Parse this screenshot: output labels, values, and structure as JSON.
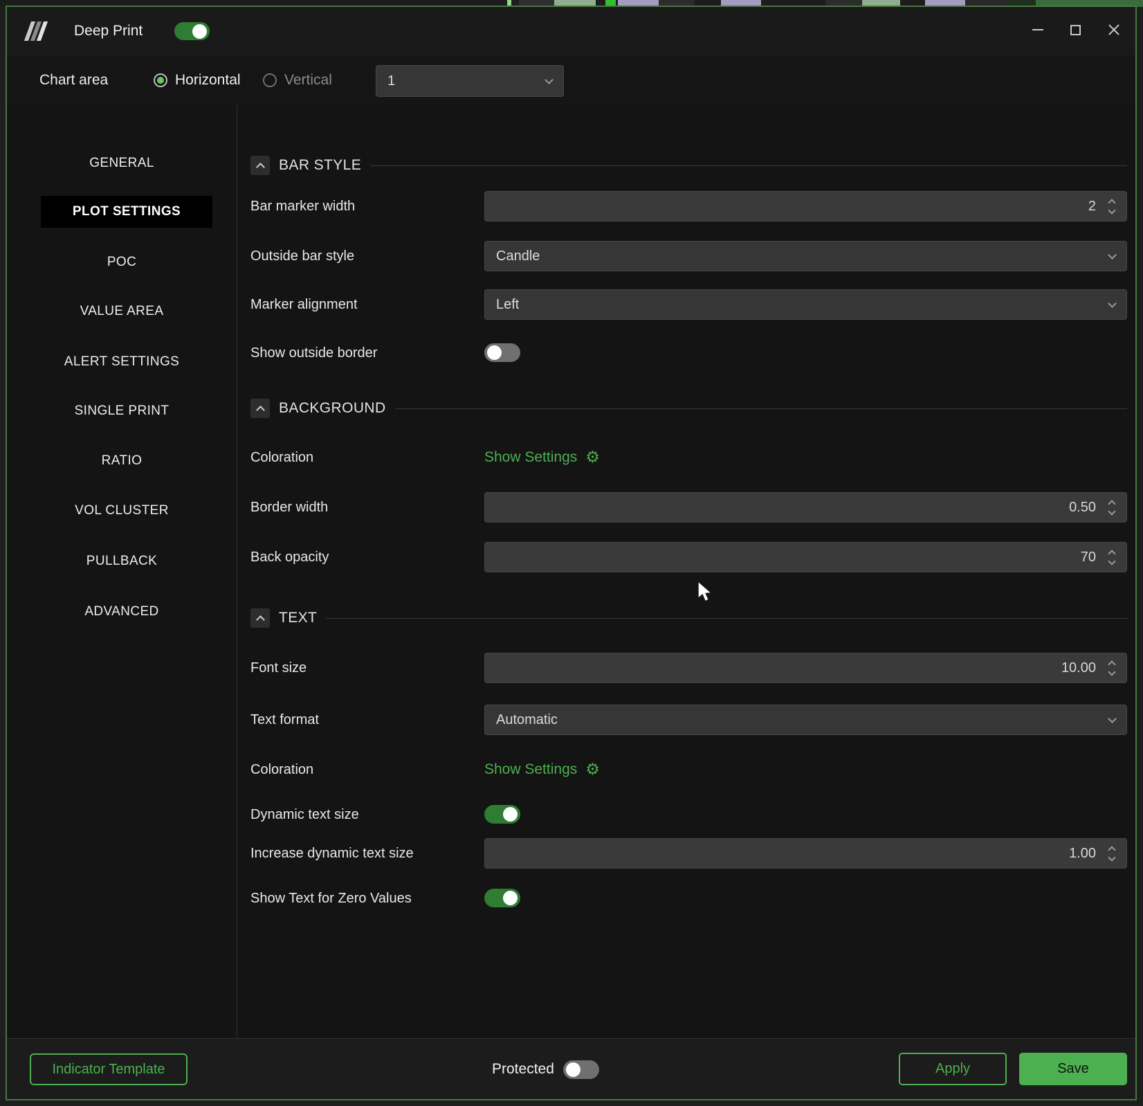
{
  "window": {
    "title": "Deep Print",
    "enabled_toggle_on": true
  },
  "chart_area": {
    "label": "Chart area",
    "options": [
      {
        "label": "Horizontal",
        "selected": true
      },
      {
        "label": "Vertical",
        "selected": false
      }
    ],
    "selected_area": "1"
  },
  "sidebar": {
    "items": [
      {
        "label": "GENERAL",
        "selected": false
      },
      {
        "label": "PLOT SETTINGS",
        "selected": true
      },
      {
        "label": "POC",
        "selected": false
      },
      {
        "label": "VALUE AREA",
        "selected": false
      },
      {
        "label": "ALERT SETTINGS",
        "selected": false
      },
      {
        "label": "SINGLE PRINT",
        "selected": false
      },
      {
        "label": "RATIO",
        "selected": false
      },
      {
        "label": "VOL CLUSTER",
        "selected": false
      },
      {
        "label": "PULLBACK",
        "selected": false
      },
      {
        "label": "ADVANCED",
        "selected": false
      }
    ]
  },
  "sections": [
    {
      "title": "BAR STYLE",
      "rows": [
        {
          "label": "Bar marker width",
          "type": "number",
          "value": "2"
        },
        {
          "label": "Outside bar style",
          "type": "dropdown",
          "value": "Candle"
        },
        {
          "label": "Marker alignment",
          "type": "dropdown",
          "value": "Left"
        },
        {
          "label": "Show outside border",
          "type": "toggle",
          "value": false
        }
      ]
    },
    {
      "title": "BACKGROUND",
      "rows": [
        {
          "label": "Coloration",
          "type": "link",
          "value": "Show Settings"
        },
        {
          "label": "Border width",
          "type": "number",
          "value": "0.50"
        },
        {
          "label": "Back opacity",
          "type": "number",
          "value": "70"
        }
      ]
    },
    {
      "title": "TEXT",
      "rows": [
        {
          "label": "Font size",
          "type": "number",
          "value": "10.00"
        },
        {
          "label": "Text format",
          "type": "dropdown",
          "value": "Automatic"
        },
        {
          "label": "Coloration",
          "type": "link",
          "value": "Show Settings"
        },
        {
          "label": "Dynamic text size",
          "type": "toggle",
          "value": true
        },
        {
          "label": "Increase dynamic text size",
          "type": "number",
          "value": "1.00"
        },
        {
          "label": "Show Text for Zero Values",
          "type": "toggle",
          "value": true
        }
      ]
    }
  ],
  "footer": {
    "template_button": "Indicator Template",
    "protected_label": "Protected",
    "protected_on": false,
    "apply_button": "Apply",
    "save_button": "Save"
  },
  "icons": {
    "logo": "deep-print-logo",
    "gear": "⚙",
    "collapse": "chevron-up",
    "dropdown": "chevron-down",
    "spinner": "chevron-up-down",
    "cursor": "arrow-pointer"
  },
  "colors": {
    "accent_green": "#4caf50",
    "toggle_on_track": "#2e7d32",
    "toggle_off_track": "#707070",
    "window_border": "#44793f",
    "selected_item_bg": "#000000",
    "field_bg": "#3a3a3a"
  }
}
